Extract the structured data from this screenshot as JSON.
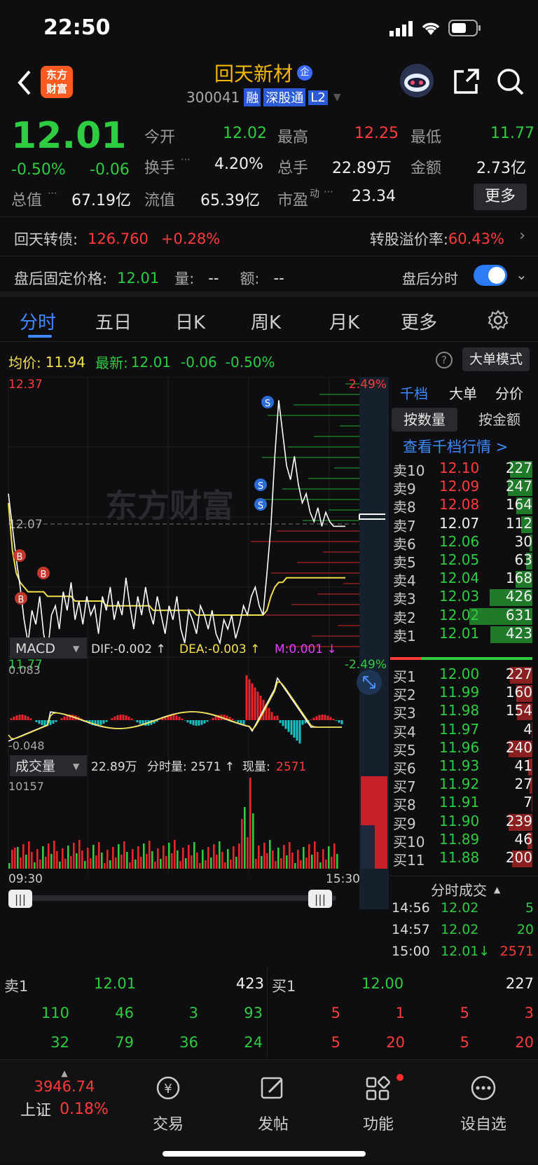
{
  "status": {
    "time": "22:50"
  },
  "header": {
    "logo_line1": "东方",
    "logo_line2": "财富",
    "stock_name": "回天新材",
    "stock_tag": "企",
    "stock_code": "300041",
    "badge_rong": "融",
    "badge_sgt": "深股通",
    "badge_l2": "L2"
  },
  "quote": {
    "price": "12.01",
    "pct": "-0.50%",
    "chg": "-0.06",
    "open_label": "今开",
    "open": "12.02",
    "high_label": "最高",
    "high": "12.25",
    "low_label": "最低",
    "low": "11.77",
    "turnover_label": "换手",
    "turnover": "4.20%",
    "vol_label": "总手",
    "vol": "22.89万",
    "amt_label": "金额",
    "amt": "2.73亿",
    "mktcap_label": "总值",
    "mktcap": "67.19亿",
    "float_label": "流值",
    "float": "65.39亿",
    "pe_label": "市盈",
    "pe_sup": "动",
    "pe": "23.34",
    "more": "更多"
  },
  "bond": {
    "label": "回天转债:",
    "price": "126.760",
    "pct": "+0.28%",
    "premium_label": "转股溢价率:",
    "premium": "60.43%"
  },
  "after_hours": {
    "label": "盘后固定价格:",
    "price": "12.01",
    "vol_label": "量:",
    "vol": "--",
    "amt_label": "额:",
    "amt": "--",
    "toggle_label": "盘后分时"
  },
  "tabs": [
    "分时",
    "五日",
    "日K",
    "周K",
    "月K",
    "更多"
  ],
  "chart_info": {
    "avg_label": "均价:",
    "avg": "11.94",
    "latest_label": "最新:",
    "latest": "12.01",
    "chg": "-0.06",
    "pct": "-0.50%",
    "big_mode": "大单模式"
  },
  "intraday": {
    "top_price": "12.37",
    "top_pct": "2.49%",
    "mid_price": "12.07",
    "bot_price": "11.77",
    "bot_pct": "-2.49%",
    "watermark": "东方财富",
    "price": [
      12.12,
      12.05,
      11.98,
      11.92,
      11.85,
      11.8,
      11.87,
      11.84,
      11.9,
      11.82,
      11.78,
      11.86,
      11.88,
      11.83,
      11.91,
      11.87,
      11.93,
      11.85,
      11.89,
      11.84,
      11.9,
      11.86,
      11.88,
      11.82,
      11.9,
      11.87,
      11.92,
      11.85,
      11.89,
      11.86,
      11.94,
      11.88,
      11.83,
      11.9,
      11.86,
      11.92,
      11.87,
      11.84,
      11.9,
      11.86,
      11.82,
      11.88,
      11.85,
      11.9,
      11.83,
      11.8,
      11.87,
      11.85,
      11.82,
      11.88,
      11.86,
      11.83,
      11.87,
      11.82,
      11.8,
      11.85,
      11.83,
      11.86,
      11.81,
      11.84,
      11.88,
      11.86,
      11.9,
      11.92,
      11.88,
      11.86,
      11.95,
      12.05,
      12.2,
      12.32,
      12.25,
      12.18,
      12.15,
      12.2,
      12.14,
      12.1,
      12.12,
      12.08,
      12.06,
      12.09,
      12.05,
      12.08,
      12.06,
      12.05,
      12.05,
      12.05,
      12.05
    ],
    "avg": [
      12.1,
      12.0,
      11.95,
      11.93,
      11.92,
      11.91,
      11.91,
      11.91,
      11.91,
      11.91,
      11.9,
      11.9,
      11.9,
      11.9,
      11.9,
      11.9,
      11.9,
      11.89,
      11.89,
      11.89,
      11.89,
      11.89,
      11.89,
      11.89,
      11.89,
      11.88,
      11.88,
      11.88,
      11.88,
      11.88,
      11.88,
      11.88,
      11.88,
      11.88,
      11.88,
      11.88,
      11.88,
      11.87,
      11.87,
      11.87,
      11.87,
      11.87,
      11.87,
      11.87,
      11.87,
      11.87,
      11.87,
      11.87,
      11.86,
      11.86,
      11.86,
      11.86,
      11.86,
      11.86,
      11.86,
      11.86,
      11.86,
      11.86,
      11.86,
      11.86,
      11.86,
      11.86,
      11.86,
      11.86,
      11.86,
      11.86,
      11.87,
      11.9,
      11.92,
      11.93,
      11.93,
      11.94,
      11.94,
      11.94,
      11.94,
      11.94,
      11.94,
      11.94,
      11.94,
      11.94,
      11.94,
      11.94,
      11.94,
      11.94,
      11.94,
      11.94,
      11.94
    ]
  },
  "macd": {
    "title": "MACD",
    "dif": "DIF:-0.002 ↑",
    "dea": "DEA:-0.003 ↑",
    "m": "M:0.001 ↓",
    "top": "0.083",
    "bot": "-0.048"
  },
  "volume": {
    "title": "成交量",
    "total": "22.89万",
    "fs_label": "分时量: 2571 ↑",
    "now_label": "现量:",
    "now": "2571",
    "top": "10157",
    "time_start": "09:30",
    "time_end": "15:30"
  },
  "orderbook": {
    "tabs": [
      "千档",
      "大单",
      "分价"
    ],
    "modes": [
      "按数量",
      "按金额"
    ],
    "link": "查看千档行情 >",
    "asks": [
      [
        "卖10",
        "12.10",
        "227"
      ],
      [
        "卖9",
        "12.09",
        "247"
      ],
      [
        "卖8",
        "12.08",
        "164"
      ],
      [
        "卖7",
        "12.07",
        "112"
      ],
      [
        "卖6",
        "12.06",
        "30"
      ],
      [
        "卖5",
        "12.05",
        "63"
      ],
      [
        "卖4",
        "12.04",
        "168"
      ],
      [
        "卖3",
        "12.03",
        "426"
      ],
      [
        "卖2",
        "12.02",
        "631"
      ],
      [
        "卖1",
        "12.01",
        "423"
      ]
    ],
    "bids": [
      [
        "买1",
        "12.00",
        "227"
      ],
      [
        "买2",
        "11.99",
        "160"
      ],
      [
        "买3",
        "11.98",
        "154"
      ],
      [
        "买4",
        "11.97",
        "4"
      ],
      [
        "买5",
        "11.96",
        "240"
      ],
      [
        "买6",
        "11.93",
        "41"
      ],
      [
        "买7",
        "11.92",
        "27"
      ],
      [
        "买8",
        "11.91",
        "7"
      ],
      [
        "买9",
        "11.90",
        "239"
      ],
      [
        "买10",
        "11.89",
        "46"
      ],
      [
        "买11",
        "11.88",
        "200"
      ]
    ]
  },
  "ticks": {
    "title": "分时成交",
    "rows": [
      [
        "14:56",
        "12.02",
        "5"
      ],
      [
        "14:57",
        "12.02",
        "20"
      ],
      [
        "15:00",
        "12.01↓",
        "2571"
      ]
    ]
  },
  "level5": {
    "sell_label": "卖1",
    "sell_price": "12.01",
    "sell_vol": "423",
    "buy_label": "买1",
    "buy_price": "12.00",
    "buy_vol": "227",
    "sell_rows": [
      [
        "110",
        "46",
        "3",
        "93"
      ],
      [
        "32",
        "79",
        "36",
        "24"
      ]
    ],
    "buy_rows": [
      [
        "5",
        "1",
        "5",
        "3"
      ],
      [
        "5",
        "20",
        "5",
        "20"
      ]
    ]
  },
  "nav": {
    "index_value": "3946.74",
    "index_name": "上证",
    "index_pct": "0.18%",
    "items": [
      "交易",
      "发帖",
      "功能",
      "设自选"
    ]
  }
}
